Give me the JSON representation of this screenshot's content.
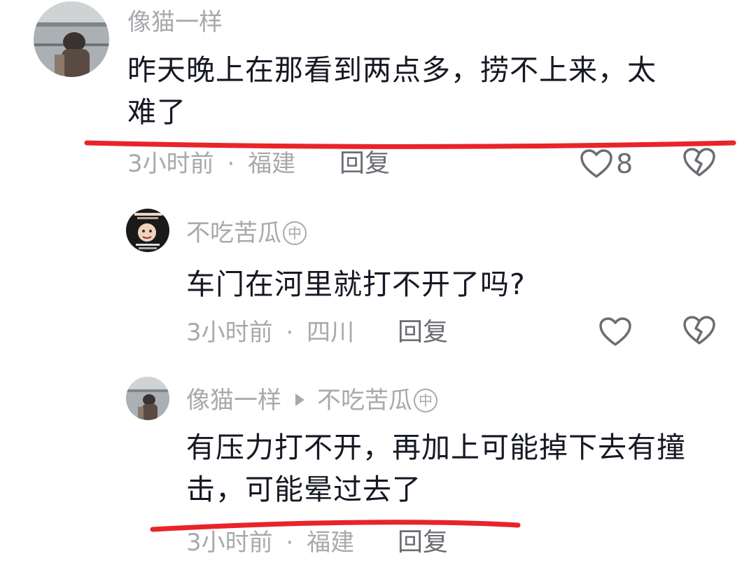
{
  "comments": [
    {
      "username": "像猫一样",
      "text_line1": "昨天晚上在那看到两点多，捞不上来，太",
      "text_line2": "难了",
      "time": "3小时前",
      "location": "福建",
      "reply_label": "回复",
      "like_count": "8"
    },
    {
      "username": "不吃苦瓜",
      "badge": "中",
      "text": "车门在河里就打不开了吗?",
      "time": "3小时前",
      "location": "四川",
      "reply_label": "回复"
    },
    {
      "username": "像猫一样",
      "reply_to": "不吃苦瓜",
      "badge": "中",
      "text_line1": "有压力打不开，再加上可能掉下去有撞",
      "text_line2": "击，可能晕过去了",
      "time": "3小时前",
      "location": "福建",
      "reply_label": "回复"
    }
  ],
  "meta_separator": "·",
  "colors": {
    "underline": "#e8242a",
    "meta_text": "#a8a9ad",
    "body_text": "#161823",
    "icon": "#6b6d73"
  },
  "icons": [
    "heart-icon",
    "broken-heart-icon",
    "reply-arrow-icon",
    "badge-icon"
  ]
}
